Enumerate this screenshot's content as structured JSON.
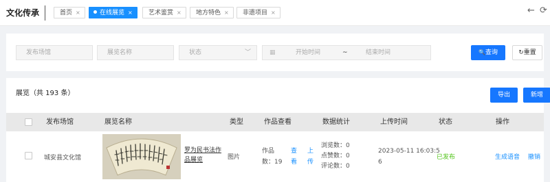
{
  "app": {
    "brand": "文化传承"
  },
  "tabs": [
    {
      "label": "首页",
      "close": "×",
      "active": false
    },
    {
      "label": "在线展览",
      "close": "×",
      "active": true
    },
    {
      "label": "艺术鉴赏",
      "close": "×",
      "active": false
    },
    {
      "label": "地方特色",
      "close": "×",
      "active": false
    },
    {
      "label": "非遗项目",
      "close": "×",
      "active": false
    }
  ],
  "nav": {
    "back_icon": "←",
    "forward_icon": "⟳"
  },
  "filters": {
    "venue_placeholder": "发布场馆",
    "name_placeholder": "展览名称",
    "status_placeholder": "状态",
    "start_placeholder": "开始时间",
    "range_sep": "~",
    "end_placeholder": "结束时间",
    "search_label": "查询",
    "search_icon": "🔍",
    "reset_label": "重置",
    "reset_icon": "↻"
  },
  "list": {
    "title": "展览（共 193 条）",
    "export_label": "导出",
    "add_label": "新增"
  },
  "table": {
    "columns": [
      "发布场馆",
      "展览名称",
      "类型",
      "作品查看",
      "数据统计",
      "上传时间",
      "状态",
      "操作"
    ],
    "rows": [
      {
        "venue": "城安县文化馆",
        "name_line1": "罗为民书法作",
        "name_line2": "品展览",
        "type": "图片",
        "works_line1": "作品",
        "works_line2": "数：19",
        "view_line1": "查",
        "view_line2": "看",
        "upload_line1": "上",
        "upload_line2": "传",
        "stats_views": "浏览数：0",
        "stats_likes": "点赞数：0",
        "stats_comments": "评论数：0",
        "time_line1": "2023-05-11 16:03:5",
        "time_line2": "6",
        "status": "已发布",
        "action_voice": "生成语音",
        "action_revoke": "撤销"
      }
    ]
  },
  "colors": {
    "primary": "#1677ff",
    "status_published": "#52c41a",
    "link": "#1890ff"
  }
}
